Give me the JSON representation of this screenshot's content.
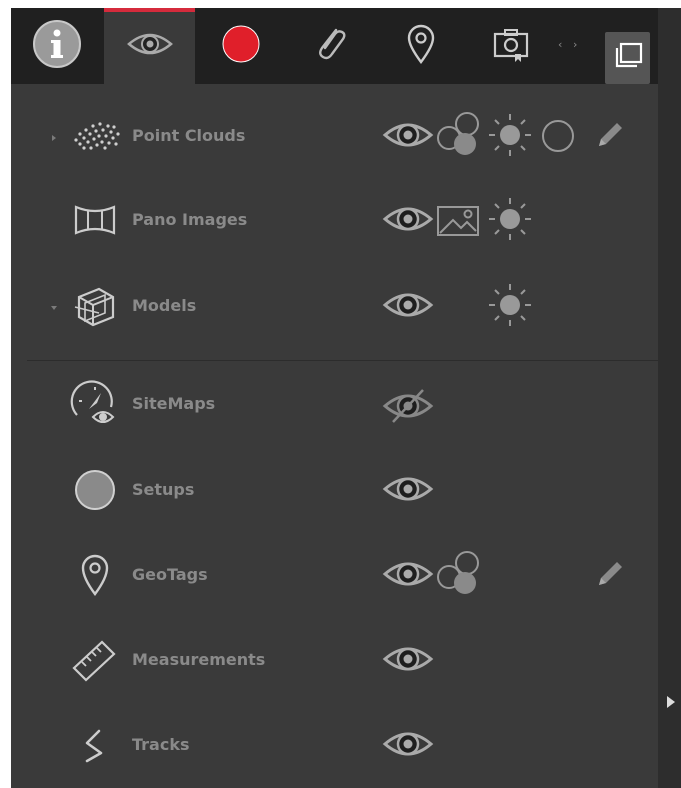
{
  "tabs": [
    {
      "name": "info",
      "icon": "info-icon",
      "active": false
    },
    {
      "name": "visibility",
      "icon": "eye-icon",
      "active": true
    },
    {
      "name": "record",
      "icon": "record-icon",
      "active": false
    },
    {
      "name": "attachment",
      "icon": "paperclip-icon",
      "active": false
    },
    {
      "name": "location",
      "icon": "map-pin-icon",
      "active": false
    },
    {
      "name": "snapshot",
      "icon": "camera-icon",
      "active": false
    }
  ],
  "accent_color": "#d52b3c",
  "record_color": "#e01f2a",
  "layers": [
    {
      "id": "point-clouds",
      "label": "Point Clouds",
      "icon": "point-cloud-icon",
      "expandable": true,
      "expanded": false
    },
    {
      "id": "pano-images",
      "label": "Pano Images",
      "icon": "panorama-icon",
      "expandable": false
    },
    {
      "id": "models",
      "label": "Models",
      "icon": "model-cube-icon",
      "expandable": true,
      "expanded": true
    },
    {
      "id": "sitemaps",
      "label": "SiteMaps",
      "icon": "sitemap-icon",
      "expandable": false,
      "visible": false
    },
    {
      "id": "setups",
      "label": "Setups",
      "icon": "setup-circle-icon",
      "expandable": false
    },
    {
      "id": "geotags",
      "label": "GeoTags",
      "icon": "geotag-pin-icon",
      "expandable": false
    },
    {
      "id": "measurements",
      "label": "Measurements",
      "icon": "ruler-icon",
      "expandable": false
    },
    {
      "id": "tracks",
      "label": "Tracks",
      "icon": "track-icon",
      "expandable": false
    }
  ]
}
